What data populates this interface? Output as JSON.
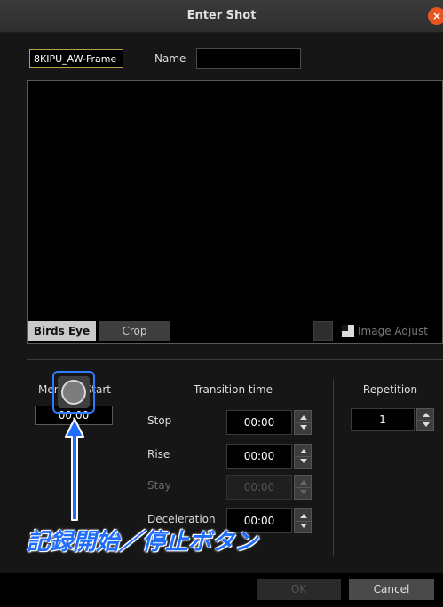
{
  "window": {
    "title": "Enter Shot",
    "close_glyph": "×"
  },
  "header": {
    "camera_name": "8KIPU_AW-Frame",
    "name_label": "Name",
    "name_value": ""
  },
  "view_tabs": {
    "birds_eye": "Birds Eye",
    "crop": "Crop"
  },
  "image_adjust": {
    "label": "Image Adjust",
    "icon": "image-adjust-icon"
  },
  "memory": {
    "title": "Memory Start",
    "time": "00:00",
    "record_icon": "record-circle-icon"
  },
  "transition": {
    "title": "Transition time",
    "rows": [
      {
        "label": "Stop",
        "value": "00:00"
      },
      {
        "label": "Rise",
        "value": "00:00"
      },
      {
        "label": "Stay",
        "value": "00:00"
      },
      {
        "label": "Deceleration",
        "value": "00:00"
      }
    ]
  },
  "repetition": {
    "title": "Repetition",
    "value": "1"
  },
  "annotation": {
    "text": "記録開始／停止ボタン",
    "color": "#1e6dff",
    "arrow_icon": "up-arrow-icon"
  },
  "footer": {
    "ok": "OK",
    "cancel": "Cancel"
  },
  "colors": {
    "accent_highlight": "#2f7bff",
    "close": "#e95420",
    "background": "#161616"
  }
}
